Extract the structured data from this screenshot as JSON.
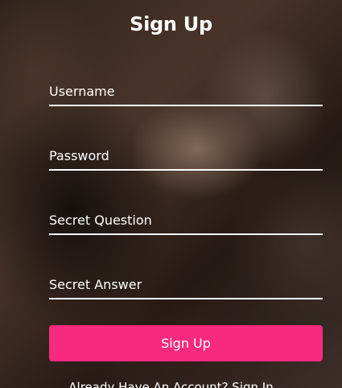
{
  "form": {
    "title": "Sign Up",
    "fields": [
      {
        "name": "username",
        "placeholder": "Username",
        "value": ""
      },
      {
        "name": "password",
        "placeholder": "Password",
        "value": ""
      },
      {
        "name": "secret_question",
        "placeholder": "Secret Question",
        "value": ""
      },
      {
        "name": "secret_answer",
        "placeholder": "Secret Answer",
        "value": ""
      }
    ],
    "submit_label": "Sign Up",
    "footer_text": "Already Have An Account? ",
    "footer_link": "Sign In"
  },
  "colors": {
    "accent": "#f72a7f",
    "text": "#ffffff"
  }
}
